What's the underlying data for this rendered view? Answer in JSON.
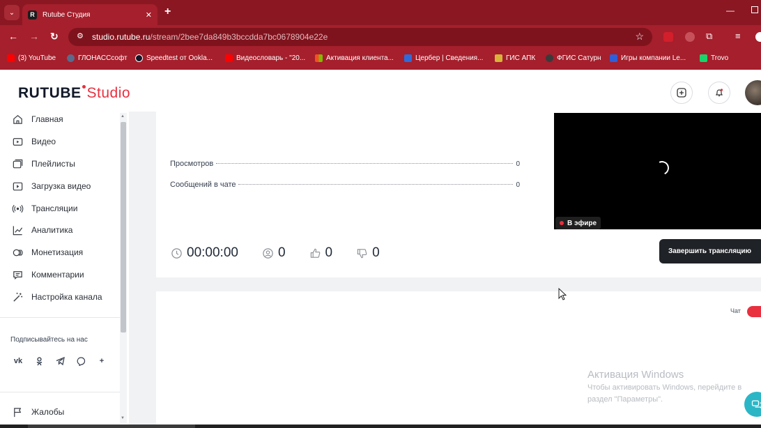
{
  "browser": {
    "tab_title": "Rutube Студия",
    "tab_favicon": "R",
    "url_host": "studio.rutube.ru",
    "url_path": "/stream/2bee7da849b3bccdda7bc0678904e22e",
    "bookmarks": [
      {
        "label": "(3) YouTube",
        "color": "#ff0000"
      },
      {
        "label": "ГЛОНАССсофт",
        "color": "#5a6b8c"
      },
      {
        "label": "Speedtest от Ookla...",
        "color": "#141526"
      },
      {
        "label": "Видеословарь - \"20...",
        "color": "#ff0000"
      },
      {
        "label": "Активация клиента...",
        "color": "#f25022"
      },
      {
        "label": "Цербер | Сведения...",
        "color": "#2f6bd8"
      },
      {
        "label": "ГИС АПК",
        "color": "#d9b23a"
      },
      {
        "label": "ФГИС Сатурн",
        "color": "#3a3a3a"
      },
      {
        "label": "Игры компании Le...",
        "color": "#2f5fd8"
      },
      {
        "label": "Trovo",
        "color": "#19d46a"
      }
    ]
  },
  "app": {
    "logo_main": "RUTUBE",
    "logo_studio": "Studio",
    "brand_color": "#e8303f"
  },
  "sidebar": {
    "items": [
      {
        "label": "Главная",
        "icon": "home-icon"
      },
      {
        "label": "Видео",
        "icon": "video-icon"
      },
      {
        "label": "Плейлисты",
        "icon": "playlist-icon"
      },
      {
        "label": "Загрузка видео",
        "icon": "upload-icon"
      },
      {
        "label": "Трансляции",
        "icon": "broadcast-icon"
      },
      {
        "label": "Аналитика",
        "icon": "analytics-icon"
      },
      {
        "label": "Монетизация",
        "icon": "coins-icon"
      },
      {
        "label": "Комментарии",
        "icon": "comment-icon"
      },
      {
        "label": "Настройка канала",
        "icon": "magic-wand-icon"
      }
    ],
    "follow_title": "Подписывайтесь на нас",
    "socials": [
      "vk-icon",
      "odnoklassniki-icon",
      "telegram-icon",
      "viber-icon",
      "plus-icon"
    ],
    "complaints_label": "Жалобы"
  },
  "stream": {
    "stats": [
      {
        "label": "Просмотров",
        "value": "0"
      },
      {
        "label": "Сообщений в чате",
        "value": "0"
      }
    ],
    "duration": "00:00:00",
    "viewers": "0",
    "likes": "0",
    "dislikes": "0",
    "live_label": "В эфире",
    "end_button": "Завершить трансляцию"
  },
  "chat": {
    "label": "Чат",
    "enabled": true
  },
  "watermark": {
    "title": "Активация Windows",
    "line1": "Чтобы активировать Windows, перейдите в",
    "line2": "раздел \"Параметры\"."
  }
}
